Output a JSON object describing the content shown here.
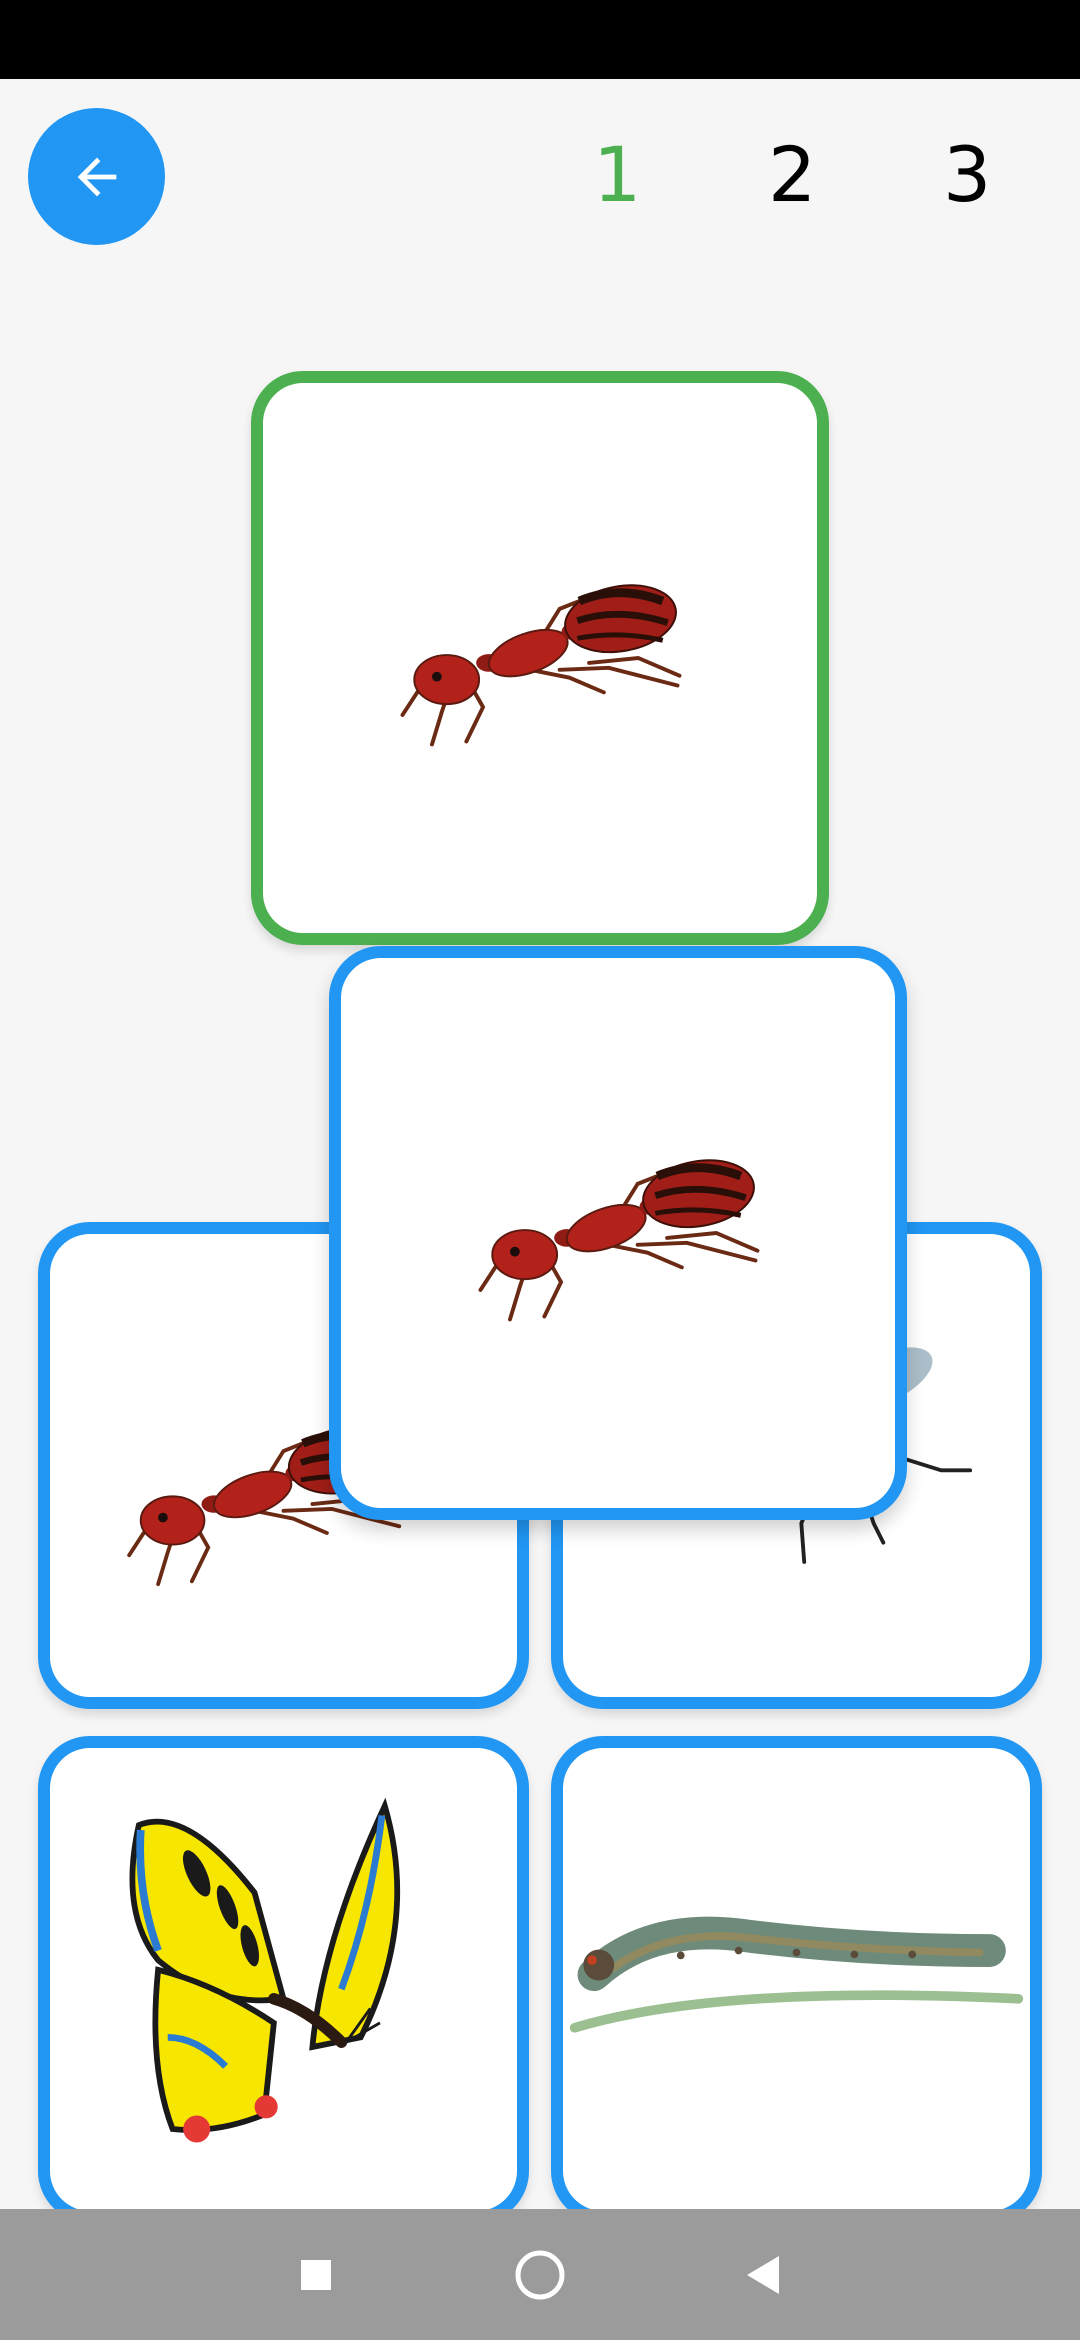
{
  "header": {
    "back_button": {
      "icon": "arrow-left-icon"
    },
    "levels": [
      {
        "label": "1",
        "active": true
      },
      {
        "label": "2",
        "active": false
      },
      {
        "label": "3",
        "active": false
      }
    ]
  },
  "cards": {
    "target": {
      "image": "ant-icon"
    },
    "dragged": {
      "image": "ant-icon"
    },
    "grid": [
      {
        "image": "ant-icon"
      },
      {
        "image": "fly-icon"
      },
      {
        "image": "butterfly-icon"
      },
      {
        "image": "caterpillar-icon"
      }
    ]
  },
  "colors": {
    "accent_blue": "#2196f3",
    "correct_green": "#4caf50",
    "background": "#f6f6f6"
  },
  "system_nav": {
    "buttons": [
      "recents-square-icon",
      "home-circle-icon",
      "back-triangle-icon"
    ]
  }
}
